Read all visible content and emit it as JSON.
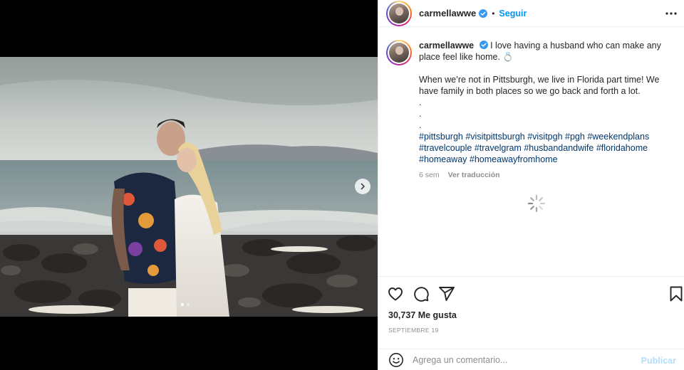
{
  "post": {
    "username": "carmellawwe",
    "verified": true,
    "separator": "•",
    "follow_label": "Seguir",
    "caption_line1": "I love having a husband who can make any place feel like home. 💍",
    "caption_line2": "When we’re not in Pittsburgh, we live in Florida part time! We have family in both places so we go back and forth a lot.",
    "dot_lines": [
      ".",
      ".",
      "."
    ],
    "hashtags": [
      "#pittsburgh",
      "#visitpittsburgh",
      "#visitpgh",
      "#pgh",
      "#weekendplans",
      "#travelcouple",
      "#travelgram",
      "#husbandandwife",
      "#floridahome",
      "#homeaway",
      "#homeawayfromhome"
    ],
    "time_ago": "6 sem",
    "translate_label": "Ver traducción",
    "likes_text": "30,737 Me gusta",
    "date_text": "SEPTIEMBRE 19"
  },
  "carousel": {
    "slide_count": 2,
    "active_index": 0
  },
  "comment": {
    "placeholder": "Agrega un comentario...",
    "publish_label": "Publicar"
  },
  "colors": {
    "link_blue": "#0095f6",
    "hashtag": "#00376b",
    "muted": "#8e8e8e",
    "publish_disabled": "#b2dffc"
  },
  "icons": [
    "verified-badge-icon",
    "more-options-icon",
    "carousel-next-icon",
    "loading-spinner-icon",
    "heart-icon",
    "comment-icon",
    "share-icon",
    "bookmark-icon",
    "emoji-icon"
  ]
}
